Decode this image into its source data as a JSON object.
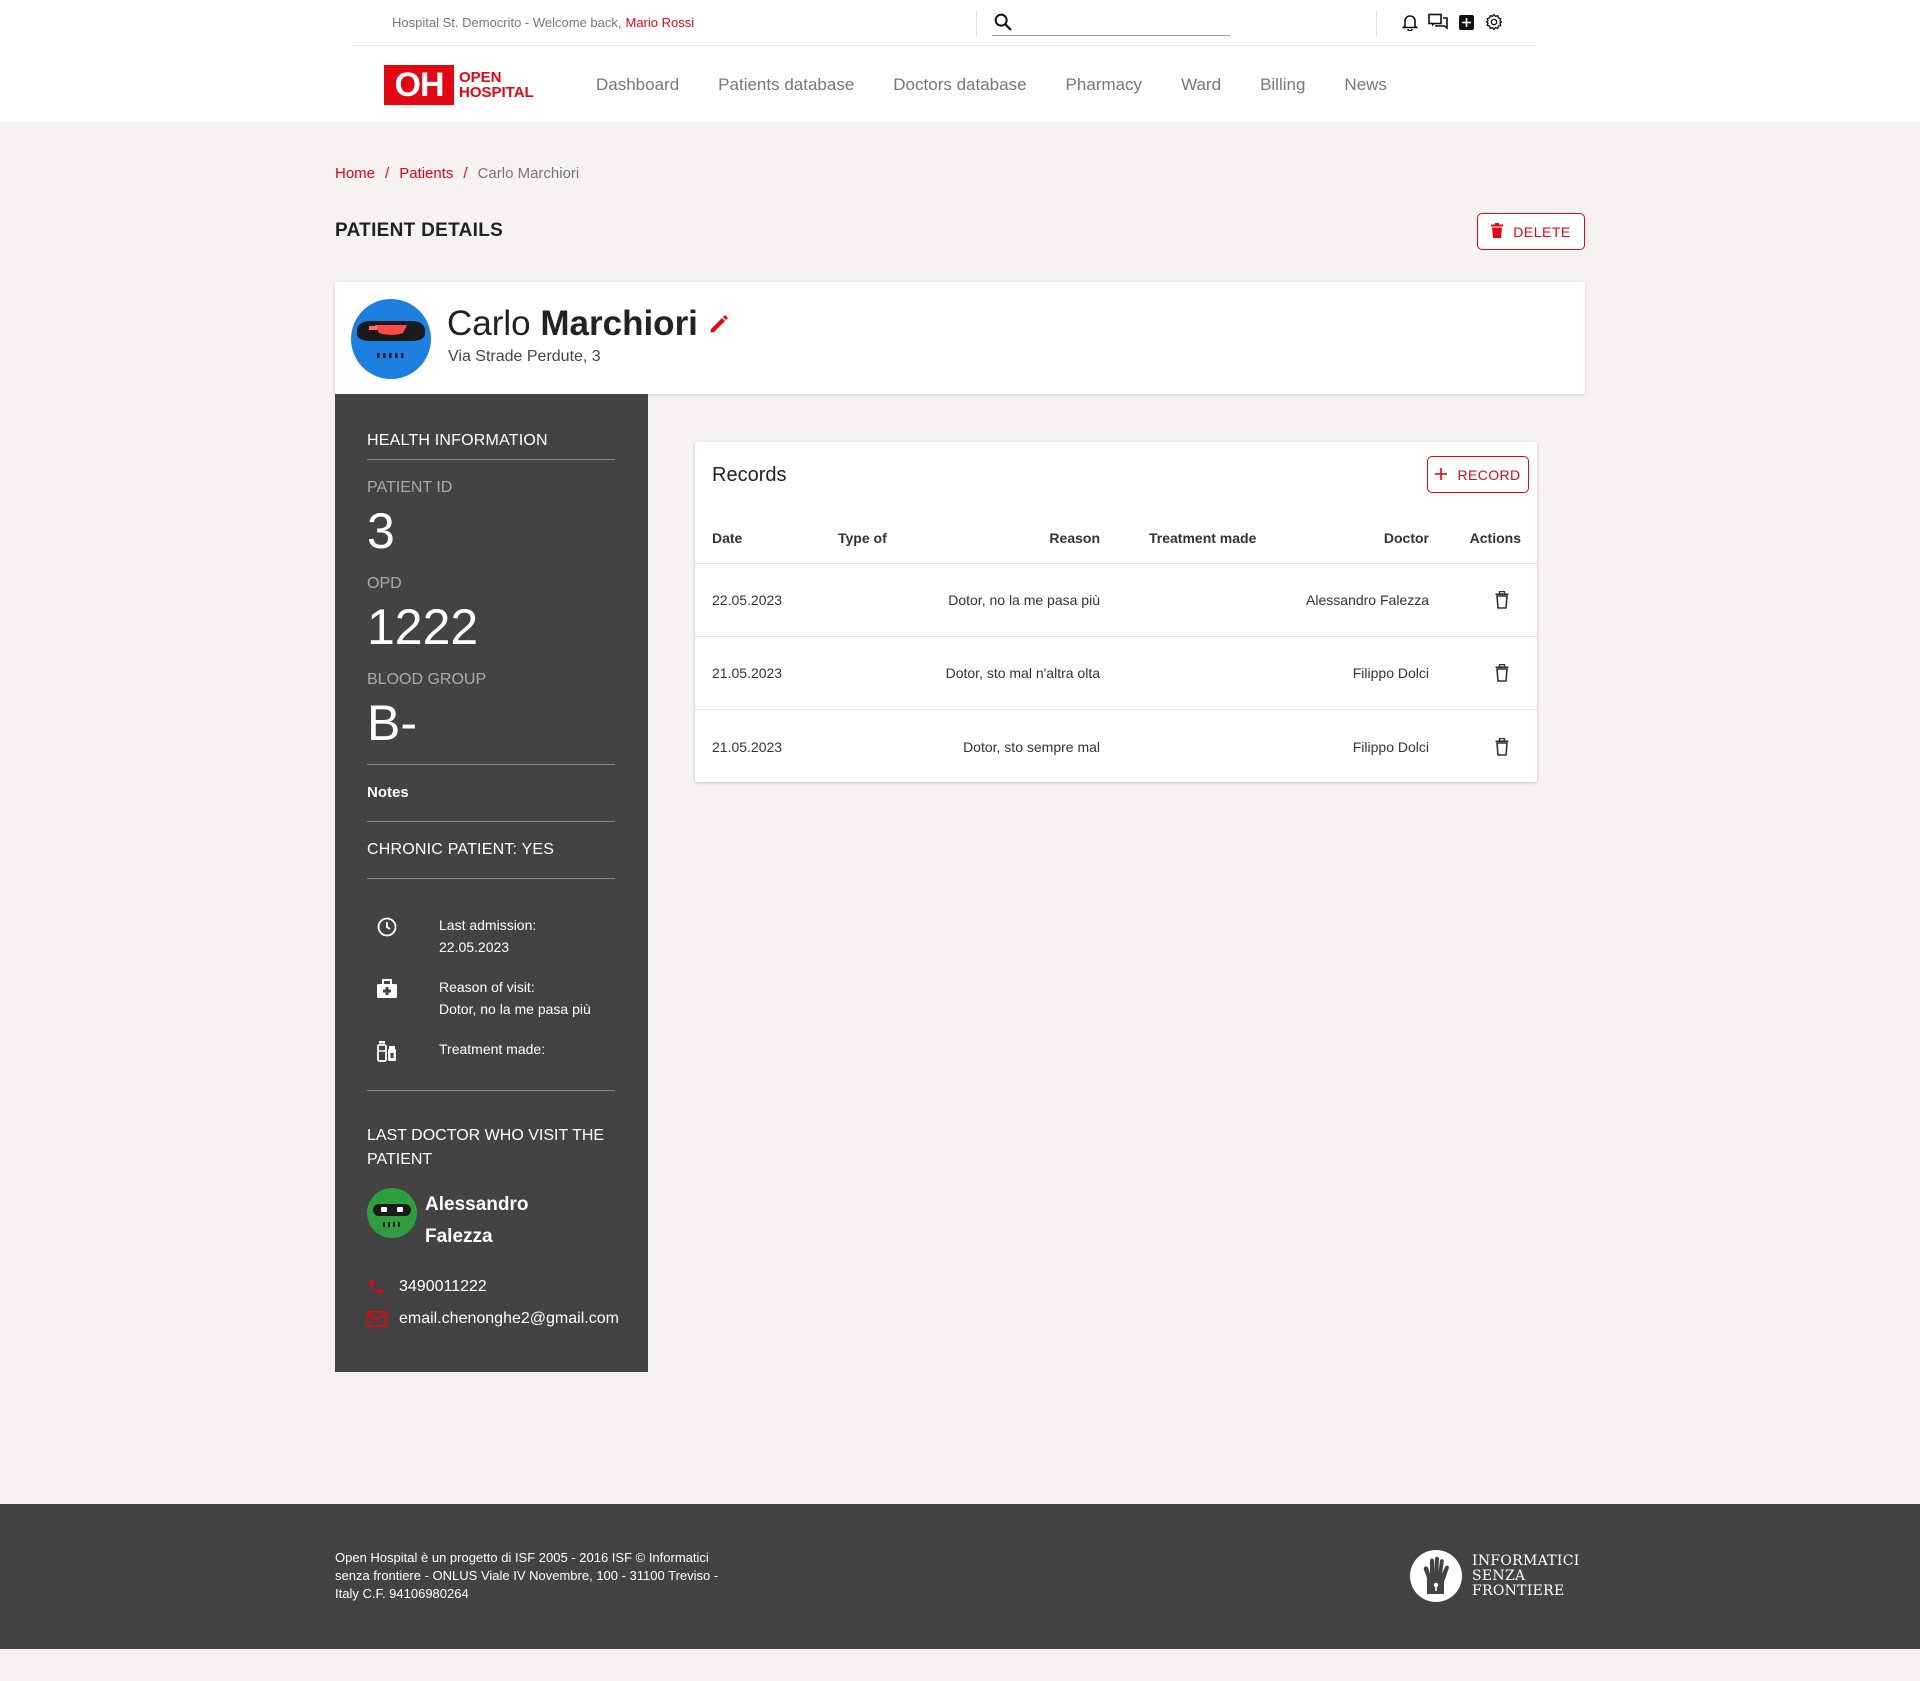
{
  "header": {
    "welcome_text": "Hospital St. Democrito - Welcome back,",
    "user_name": "Mario Rossi",
    "search_placeholder": "",
    "icons": [
      "bell-icon",
      "chat-icon",
      "apps-icon",
      "settings-icon"
    ]
  },
  "logo": {
    "mark": "OH",
    "line1": "OPEN",
    "line2": "HOSPITAL"
  },
  "nav": {
    "items": [
      "Dashboard",
      "Patients database",
      "Doctors database",
      "Pharmacy",
      "Ward",
      "Billing",
      "News"
    ]
  },
  "breadcrumb": {
    "home": "Home",
    "patients": "Patients",
    "current": "Carlo Marchiori",
    "separator": "/"
  },
  "page": {
    "title": "PATIENT DETAILS",
    "delete_label": "DELETE"
  },
  "patient": {
    "first_name": "Carlo",
    "last_name": "Marchiori",
    "address": "Via Strade Perdute, 3"
  },
  "health": {
    "title": "HEALTH INFORMATION",
    "patient_id_label": "PATIENT ID",
    "patient_id": "3",
    "opd_label": "OPD",
    "opd": "1222",
    "blood_group_label": "BLOOD GROUP",
    "blood_group": "B-",
    "notes_label": "Notes",
    "chronic": "CHRONIC PATIENT: YES",
    "last_admission_label": "Last admission:",
    "last_admission": "22.05.2023",
    "reason_label": "Reason of visit:",
    "reason": "Dotor, no la me pasa più",
    "treatment_label": "Treatment made:",
    "treatment": ""
  },
  "last_doctor": {
    "title": "LAST DOCTOR WHO VISIT THE PATIENT",
    "first_name": "Alessandro",
    "last_name": "Falezza",
    "phone": "3490011222",
    "email": "email.chenonghe2@gmail.com"
  },
  "records": {
    "title": "Records",
    "add_label": "RECORD",
    "columns": [
      "Date",
      "Type of",
      "Reason",
      "Treatment made",
      "Doctor",
      "Actions"
    ],
    "rows": [
      {
        "date": "22.05.2023",
        "type": "",
        "reason": "Dotor, no la me pasa più",
        "treatment": "",
        "doctor": "Alessandro Falezza"
      },
      {
        "date": "21.05.2023",
        "type": "",
        "reason": "Dotor, sto mal n'altra olta",
        "treatment": "",
        "doctor": "Filippo Dolci"
      },
      {
        "date": "21.05.2023",
        "type": "",
        "reason": "Dotor, sto sempre mal",
        "treatment": "",
        "doctor": "Filippo Dolci"
      }
    ]
  },
  "footer": {
    "text": "Open Hospital è un progetto di ISF 2005 - 2016 ISF © Informatici senza frontiere - ONLUS Viale IV Novembre, 100 - 31100 Treviso - Italy C.F. 94106980264",
    "org_line1": "INFORMATICI",
    "org_line2": "SENZA",
    "org_line3": "FRONTIERE"
  },
  "colors": {
    "accent": "#e30613",
    "sidebar": "#434343",
    "background": "#f5f2f1",
    "patient_avatar": "#1d7fe0",
    "doctor_avatar": "#2e9e3e"
  }
}
